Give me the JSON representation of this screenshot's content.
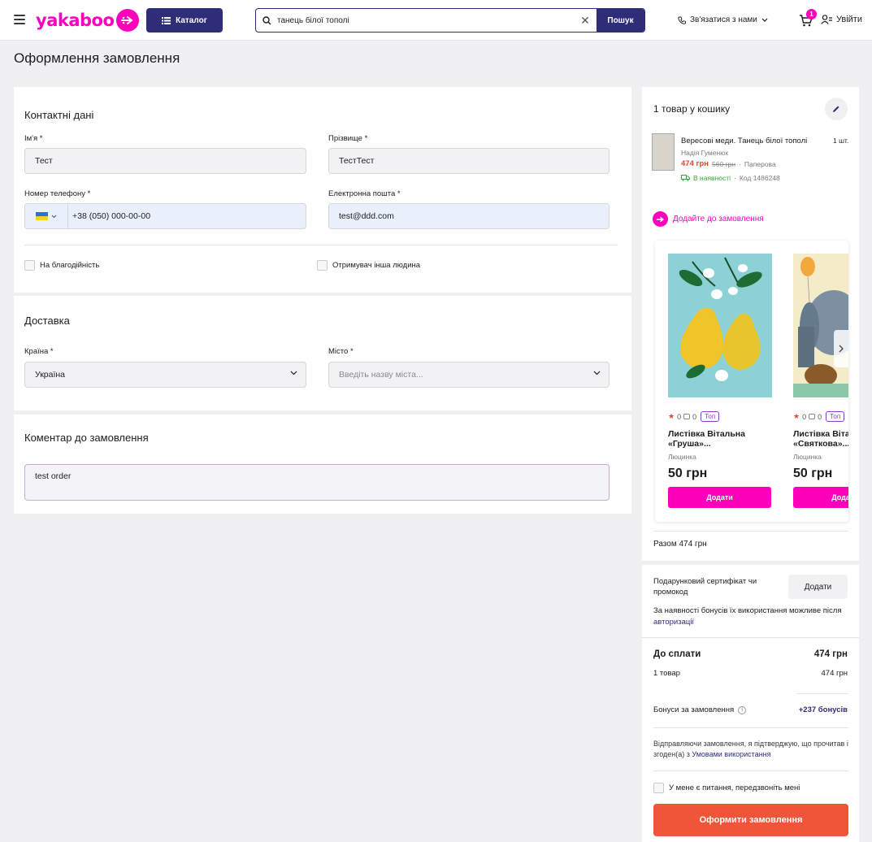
{
  "header": {
    "logo_text": "yakaboo",
    "catalog_label": "Каталог",
    "search_value": "танець білої тополі",
    "search_button": "Пошук",
    "contact_label": "Зв'язатися з нами",
    "cart_count": "1",
    "login_label": "Увійти"
  },
  "page": {
    "title": "Оформлення замовлення"
  },
  "contact": {
    "title": "Контактні дані",
    "first_name_label": "Ім'я *",
    "first_name_value": "Тест",
    "last_name_label": "Прізвище *",
    "last_name_value": "ТестТест",
    "phone_label": "Номер телефону *",
    "phone_value": "+38 (050) 000-00-00",
    "email_label": "Електронна пошта *",
    "email_value": "test@ddd.com",
    "charity_label": "На благодійність",
    "other_recipient_label": "Отримувач інша людина"
  },
  "delivery": {
    "title": "Доставка",
    "country_label": "Країна *",
    "country_value": "Україна",
    "city_label": "Місто *",
    "city_placeholder": "Введіть назву міста..."
  },
  "comment": {
    "title": "Коментар до замовлення",
    "value": "test order"
  },
  "cart": {
    "title": "1 товар у кошику",
    "item": {
      "name": "Вересові меди. Танець білої тополі",
      "author": "Надія Гуменюк",
      "price": "474 грн",
      "old_price": "560 грн",
      "format": "Паперова",
      "stock": "В наявності",
      "code": "Код 1486248",
      "qty": "1 шт."
    },
    "add_to_order": "Додайте до замовлення",
    "products": [
      {
        "rating": "0",
        "reviews": "0",
        "badge": "Топ",
        "name": "Листівка Вітальна «Груша»...",
        "author": "Люцинка",
        "price": "50 грн",
        "add": "Додати"
      },
      {
        "rating": "0",
        "reviews": "0",
        "badge": "Топ",
        "name": "Листівка Вітальна «Святкова»...",
        "author": "Люцинка",
        "price": "50 грн",
        "add": "Додати"
      }
    ],
    "total": "Разом 474 грн"
  },
  "summary": {
    "promo_label": "Подарунковий сертифікат чи промокод",
    "promo_button": "Додати",
    "bonus_note": "За наявності бонусів їх використання можливе після",
    "bonus_link": "авторизації",
    "pay_label": "До сплати",
    "pay_value": "474 грн",
    "items_label": "1 товар",
    "items_value": "474 грн",
    "bonuses_label": "Бонуси за замовлення",
    "bonuses_value": "+237 бонусів",
    "terms_text": "Відправляючи замовлення, я підтверджую, що прочитав і згоден(а) з",
    "terms_link": "Умовами використання",
    "callback_label": "У мене є питання, передзвоніть мені",
    "submit_label": "Оформити замовлення"
  }
}
